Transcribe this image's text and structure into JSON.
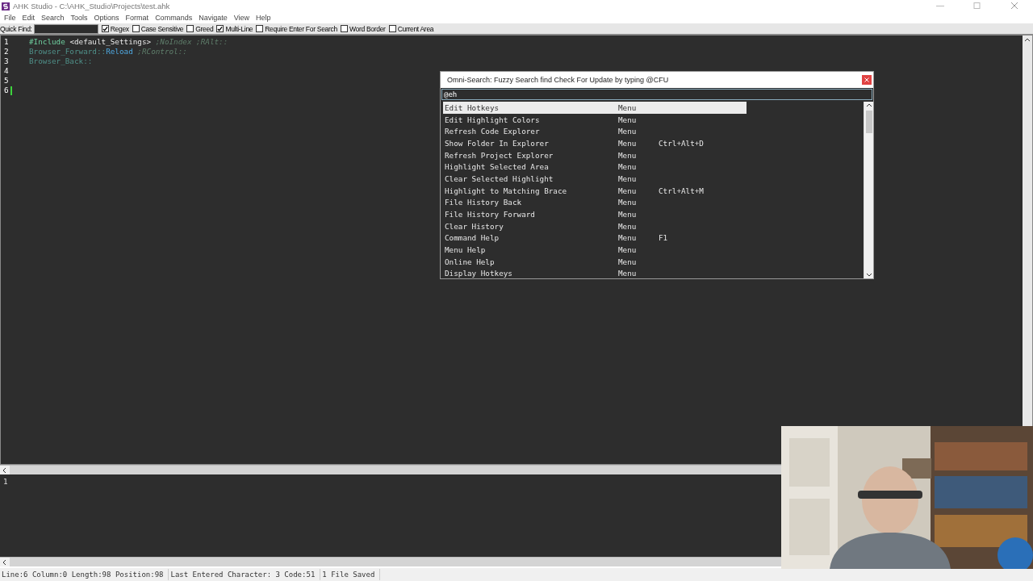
{
  "window": {
    "title": "AHK Studio - C:\\AHK_Studio\\Projects\\test.ahk"
  },
  "menu": [
    "File",
    "Edit",
    "Search",
    "Tools",
    "Options",
    "Format",
    "Commands",
    "Navigate",
    "View",
    "Help"
  ],
  "quick_find": {
    "label": "Quick Find:",
    "options": [
      {
        "label": "Regex",
        "checked": true
      },
      {
        "label": "Case Sensitive",
        "checked": false
      },
      {
        "label": "Greed",
        "checked": false
      },
      {
        "label": "Multi-Line",
        "checked": true
      },
      {
        "label": "Require Enter For Search",
        "checked": false
      },
      {
        "label": "Word Border",
        "checked": false
      },
      {
        "label": "Current Area",
        "checked": false
      }
    ]
  },
  "editor": {
    "lines": [
      {
        "number": "1",
        "tokens": [
          {
            "text": "#Include",
            "kind": "directive"
          },
          {
            "text": " <default_Settings> ",
            "kind": "plain"
          },
          {
            "text": ";NoIndex ;RAlt::",
            "kind": "comment"
          }
        ]
      },
      {
        "number": "2",
        "tokens": [
          {
            "text": "Browser_Forward::",
            "kind": "hotkey"
          },
          {
            "text": "Reload",
            "kind": "command"
          },
          {
            "text": " ;RControl::",
            "kind": "comment"
          }
        ]
      },
      {
        "number": "3",
        "tokens": [
          {
            "text": "Browser_Back::",
            "kind": "hotkey"
          }
        ]
      },
      {
        "number": "4"
      },
      {
        "number": "5"
      },
      {
        "number": "6",
        "caret": true
      }
    ]
  },
  "omni_search": {
    "title": "Omni-Search: Fuzzy Search find Check For Update by typing @CFU",
    "query": "@eh",
    "results": [
      {
        "name": "Edit Hotkeys",
        "type": "Menu",
        "selected": true
      },
      {
        "name": "Edit Highlight Colors",
        "type": "Menu",
        "selected": false
      },
      {
        "name": "Refresh Code Explorer",
        "type": "Menu",
        "selected": false
      },
      {
        "name": "Show Folder In Explorer",
        "type": "Menu",
        "hotkey": "Ctrl+Alt+D",
        "selected": false
      },
      {
        "name": "Refresh Project Explorer",
        "type": "Menu",
        "selected": false
      },
      {
        "name": "Highlight Selected Area",
        "type": "Menu",
        "selected": false
      },
      {
        "name": "Clear Selected Highlight",
        "type": "Menu",
        "selected": false
      },
      {
        "name": "Highlight to Matching Brace",
        "type": "Menu",
        "hotkey": "Ctrl+Alt+M",
        "selected": false
      },
      {
        "name": "File History Back",
        "type": "Menu",
        "selected": false
      },
      {
        "name": "File History Forward",
        "type": "Menu",
        "selected": false
      },
      {
        "name": "Clear History",
        "type": "Menu",
        "selected": false
      },
      {
        "name": "Command Help",
        "type": "Menu",
        "hotkey": "F1",
        "selected": false
      },
      {
        "name": "Menu Help",
        "type": "Menu",
        "selected": false
      },
      {
        "name": "Online Help",
        "type": "Menu",
        "selected": false
      },
      {
        "name": "Display Hotkeys",
        "type": "Menu",
        "selected": false
      }
    ]
  },
  "output": {
    "lines": [
      "1"
    ]
  },
  "status_bar": [
    "Line:6 Column:0 Length:98 Position:98",
    "Last Entered Character: 3 Code:51",
    "1 File Saved"
  ]
}
